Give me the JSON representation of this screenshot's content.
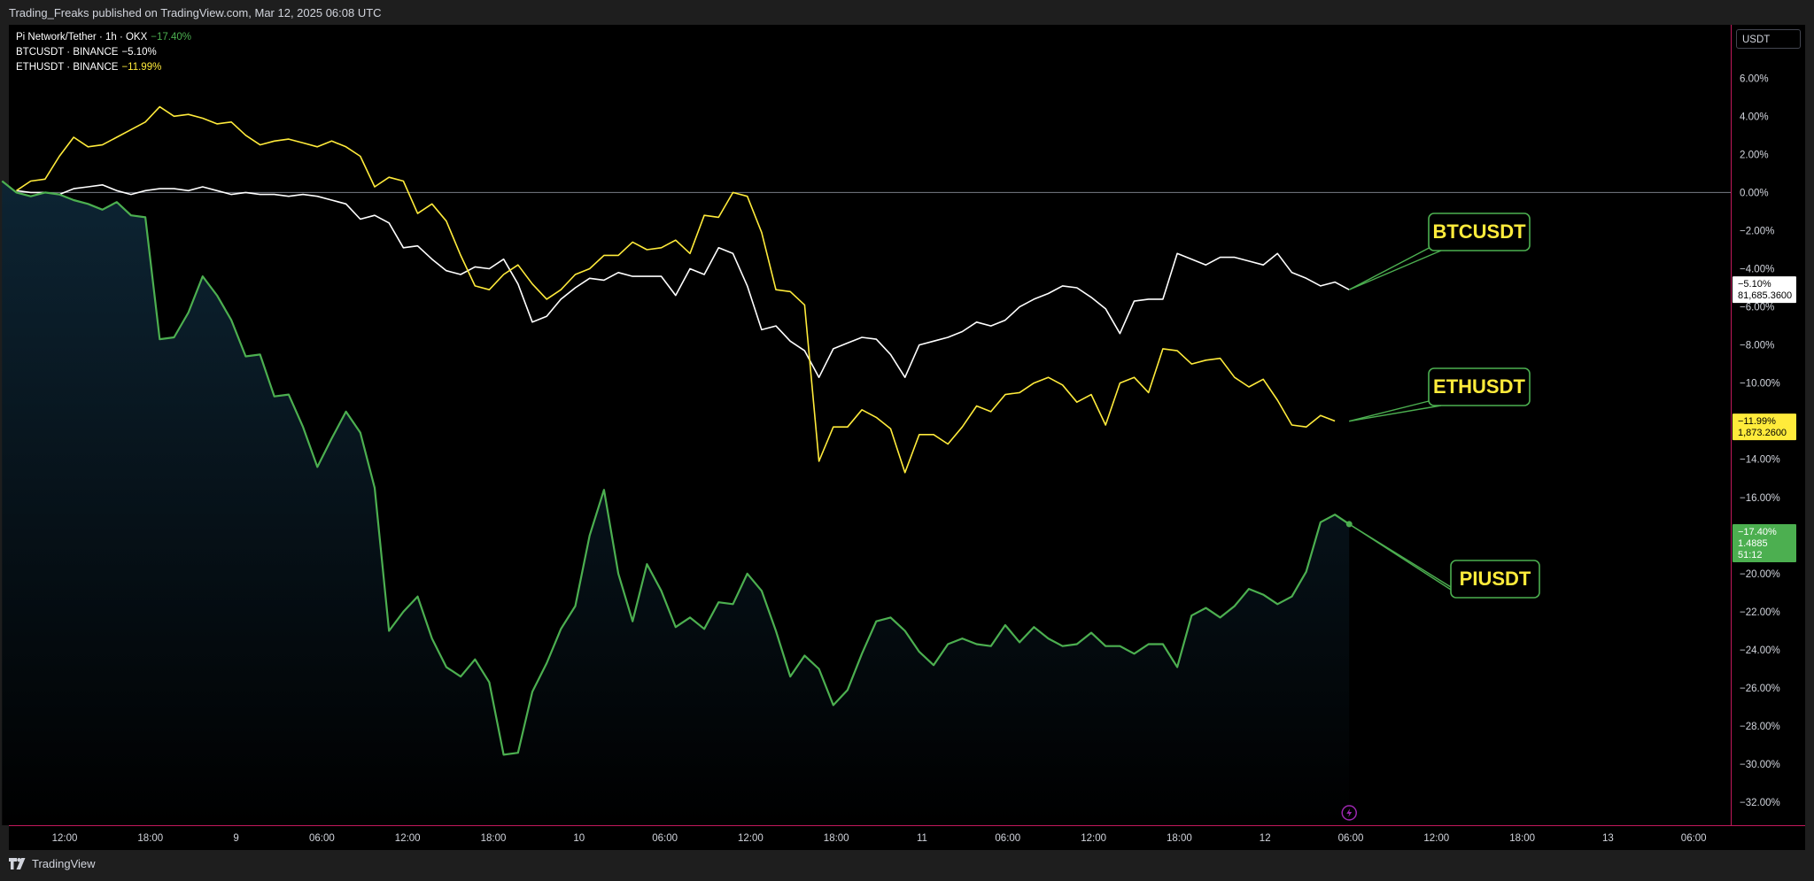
{
  "publisher_text": "Trading_Freaks published on TradingView.com, Mar 12, 2025 06:08 UTC",
  "brand": "TradingView",
  "currency_button": "USDT",
  "legend": [
    {
      "label": "Pi Network/Tether · 1h · OKX",
      "change": "−17.40%",
      "color": "#4caf50"
    },
    {
      "label": "BTCUSDT · BINANCE",
      "change": "−5.10%",
      "color": "#ffffff"
    },
    {
      "label": "ETHUSDT · BINANCE",
      "change": "−11.99%",
      "color": "#ffeb3b"
    }
  ],
  "chart_data": {
    "type": "line",
    "x_tick_labels": [
      "12:00",
      "18:00",
      "9",
      "06:00",
      "12:00",
      "18:00",
      "10",
      "06:00",
      "12:00",
      "18:00",
      "11",
      "06:00",
      "12:00",
      "18:00",
      "12",
      "06:00",
      "12:00",
      "18:00",
      "13",
      "06:00"
    ],
    "y_tick_labels": [
      "6.00%",
      "4.00%",
      "2.00%",
      "0.00%",
      "−2.00%",
      "−4.00%",
      "−6.00%",
      "−8.00%",
      "−10.00%",
      "−12.00%",
      "−14.00%",
      "−16.00%",
      "−18.00%",
      "−20.00%",
      "−22.00%",
      "−24.00%",
      "−26.00%",
      "−28.00%",
      "−30.00%",
      "−32.00%"
    ],
    "ylim": [
      -33.2,
      8.8
    ],
    "x_unit": "hours from Mar 8 06:00",
    "xlim": [
      -1.5,
      95
    ],
    "series": [
      {
        "name": "BTCUSDT",
        "color": "#ffffff",
        "points": [
          [
            0,
            0.1
          ],
          [
            1,
            0
          ],
          [
            2,
            0
          ],
          [
            3,
            -0.1
          ],
          [
            4,
            0.2
          ],
          [
            5,
            0.3
          ],
          [
            6,
            0.4
          ],
          [
            7,
            0.1
          ],
          [
            8,
            -0.1
          ],
          [
            9,
            0.1
          ],
          [
            10,
            0.2
          ],
          [
            11,
            0.2
          ],
          [
            12,
            0.1
          ],
          [
            13,
            0.3
          ],
          [
            14,
            0.1
          ],
          [
            15,
            -0.1
          ],
          [
            16,
            0
          ],
          [
            17,
            -0.1
          ],
          [
            18,
            -0.1
          ],
          [
            19,
            -0.2
          ],
          [
            20,
            -0.1
          ],
          [
            21,
            -0.2
          ],
          [
            22,
            -0.4
          ],
          [
            23,
            -0.6
          ],
          [
            24,
            -1.4
          ],
          [
            25,
            -1.2
          ],
          [
            26,
            -1.6
          ],
          [
            27,
            -2.9
          ],
          [
            28,
            -2.8
          ],
          [
            29,
            -3.5
          ],
          [
            30,
            -4.1
          ],
          [
            31,
            -4.3
          ],
          [
            32,
            -3.9
          ],
          [
            33,
            -4.0
          ],
          [
            34,
            -3.5
          ],
          [
            35,
            -4.8
          ],
          [
            36,
            -6.8
          ],
          [
            37,
            -6.5
          ],
          [
            38,
            -5.6
          ],
          [
            39,
            -5.0
          ],
          [
            40,
            -4.5
          ],
          [
            41,
            -4.6
          ],
          [
            42,
            -4.2
          ],
          [
            43,
            -4.4
          ],
          [
            44,
            -4.4
          ],
          [
            45,
            -4.4
          ],
          [
            46,
            -5.4
          ],
          [
            47,
            -4.0
          ],
          [
            48,
            -4.3
          ],
          [
            49,
            -2.9
          ],
          [
            50,
            -3.2
          ],
          [
            51,
            -4.9
          ],
          [
            52,
            -7.2
          ],
          [
            53,
            -7.0
          ],
          [
            54,
            -7.8
          ],
          [
            55,
            -8.3
          ],
          [
            56,
            -9.7
          ],
          [
            57,
            -8.2
          ],
          [
            58,
            -7.9
          ],
          [
            59,
            -7.6
          ],
          [
            60,
            -7.7
          ],
          [
            61,
            -8.5
          ],
          [
            62,
            -9.7
          ],
          [
            63,
            -8.0
          ],
          [
            64,
            -7.8
          ],
          [
            65,
            -7.6
          ],
          [
            66,
            -7.3
          ],
          [
            67,
            -6.8
          ],
          [
            68,
            -7.0
          ],
          [
            69,
            -6.7
          ],
          [
            70,
            -6.0
          ],
          [
            71,
            -5.6
          ],
          [
            72,
            -5.3
          ],
          [
            73,
            -4.9
          ],
          [
            74,
            -5.0
          ],
          [
            75,
            -5.5
          ],
          [
            76,
            -6.1
          ],
          [
            77,
            -7.4
          ],
          [
            78,
            -5.7
          ],
          [
            79,
            -5.6
          ],
          [
            80,
            -5.6
          ],
          [
            81,
            -3.2
          ],
          [
            82,
            -3.5
          ],
          [
            83,
            -3.8
          ],
          [
            84,
            -3.4
          ],
          [
            85,
            -3.4
          ],
          [
            86,
            -3.6
          ],
          [
            87,
            -3.8
          ],
          [
            88,
            -3.2
          ],
          [
            89,
            -4.2
          ],
          [
            90,
            -4.5
          ],
          [
            91,
            -4.9
          ],
          [
            92,
            -4.7
          ],
          [
            93,
            -5.1
          ]
        ]
      },
      {
        "name": "ETHUSDT",
        "color": "#ffeb3b",
        "points": [
          [
            0,
            0.1
          ],
          [
            1,
            0.6
          ],
          [
            2,
            0.7
          ],
          [
            3,
            1.9
          ],
          [
            4,
            2.9
          ],
          [
            5,
            2.4
          ],
          [
            6,
            2.5
          ],
          [
            7,
            2.9
          ],
          [
            8,
            3.3
          ],
          [
            9,
            3.7
          ],
          [
            10,
            4.5
          ],
          [
            11,
            4.0
          ],
          [
            12,
            4.1
          ],
          [
            13,
            3.9
          ],
          [
            14,
            3.6
          ],
          [
            15,
            3.7
          ],
          [
            16,
            3.0
          ],
          [
            17,
            2.5
          ],
          [
            18,
            2.7
          ],
          [
            19,
            2.8
          ],
          [
            20,
            2.6
          ],
          [
            21,
            2.4
          ],
          [
            22,
            2.7
          ],
          [
            23,
            2.4
          ],
          [
            24,
            1.9
          ],
          [
            25,
            0.3
          ],
          [
            26,
            0.8
          ],
          [
            27,
            0.6
          ],
          [
            28,
            -1.1
          ],
          [
            29,
            -0.6
          ],
          [
            30,
            -1.5
          ],
          [
            31,
            -3.3
          ],
          [
            32,
            -4.9
          ],
          [
            33,
            -5.1
          ],
          [
            34,
            -4.3
          ],
          [
            35,
            -3.8
          ],
          [
            36,
            -4.8
          ],
          [
            37,
            -5.6
          ],
          [
            38,
            -5.1
          ],
          [
            39,
            -4.3
          ],
          [
            40,
            -4.0
          ],
          [
            41,
            -3.3
          ],
          [
            42,
            -3.3
          ],
          [
            43,
            -2.6
          ],
          [
            44,
            -3.0
          ],
          [
            45,
            -2.9
          ],
          [
            46,
            -2.5
          ],
          [
            47,
            -3.2
          ],
          [
            48,
            -1.2
          ],
          [
            49,
            -1.3
          ],
          [
            50,
            0
          ],
          [
            51,
            -0.2
          ],
          [
            52,
            -2.1
          ],
          [
            53,
            -5.1
          ],
          [
            54,
            -5.2
          ],
          [
            55,
            -5.9
          ],
          [
            56,
            -14.1
          ],
          [
            57,
            -12.3
          ],
          [
            58,
            -12.3
          ],
          [
            59,
            -11.4
          ],
          [
            60,
            -11.8
          ],
          [
            61,
            -12.4
          ],
          [
            62,
            -14.7
          ],
          [
            63,
            -12.7
          ],
          [
            64,
            -12.7
          ],
          [
            65,
            -13.2
          ],
          [
            66,
            -12.3
          ],
          [
            67,
            -11.2
          ],
          [
            68,
            -11.5
          ],
          [
            69,
            -10.6
          ],
          [
            70,
            -10.5
          ],
          [
            71,
            -10.0
          ],
          [
            72,
            -9.7
          ],
          [
            73,
            -10.1
          ],
          [
            74,
            -11.0
          ],
          [
            75,
            -10.6
          ],
          [
            76,
            -12.2
          ],
          [
            77,
            -10.0
          ],
          [
            78,
            -9.7
          ],
          [
            79,
            -10.5
          ],
          [
            80,
            -8.2
          ],
          [
            81,
            -8.3
          ],
          [
            82,
            -9.0
          ],
          [
            83,
            -8.8
          ],
          [
            84,
            -8.7
          ],
          [
            85,
            -9.7
          ],
          [
            86,
            -10.2
          ],
          [
            87,
            -9.8
          ],
          [
            88,
            -10.9
          ],
          [
            89,
            -12.2
          ],
          [
            90,
            -12.3
          ],
          [
            91,
            -11.7
          ],
          [
            92,
            -11.99
          ]
        ]
      },
      {
        "name": "PIUSDT",
        "color": "#4caf50",
        "points": [
          [
            -1,
            0.6
          ],
          [
            0,
            0
          ],
          [
            1,
            -0.2
          ],
          [
            2,
            0
          ],
          [
            3,
            -0.1
          ],
          [
            4,
            -0.4
          ],
          [
            5,
            -0.6
          ],
          [
            6,
            -0.9
          ],
          [
            7,
            -0.5
          ],
          [
            8,
            -1.2
          ],
          [
            9,
            -1.3
          ],
          [
            10,
            -7.7
          ],
          [
            11,
            -7.6
          ],
          [
            12,
            -6.3
          ],
          [
            13,
            -4.4
          ],
          [
            14,
            -5.4
          ],
          [
            15,
            -6.7
          ],
          [
            16,
            -8.6
          ],
          [
            17,
            -8.5
          ],
          [
            18,
            -10.7
          ],
          [
            19,
            -10.6
          ],
          [
            20,
            -12.3
          ],
          [
            21,
            -14.4
          ],
          [
            22,
            -12.9
          ],
          [
            23,
            -11.5
          ],
          [
            24,
            -12.6
          ],
          [
            25,
            -15.5
          ],
          [
            26,
            -23.0
          ],
          [
            27,
            -22.0
          ],
          [
            28,
            -21.2
          ],
          [
            29,
            -23.4
          ],
          [
            30,
            -24.9
          ],
          [
            31,
            -25.4
          ],
          [
            32,
            -24.5
          ],
          [
            33,
            -25.7
          ],
          [
            34,
            -29.5
          ],
          [
            35,
            -29.4
          ],
          [
            36,
            -26.2
          ],
          [
            37,
            -24.7
          ],
          [
            38,
            -22.9
          ],
          [
            39,
            -21.7
          ],
          [
            40,
            -18.0
          ],
          [
            41,
            -15.6
          ],
          [
            42,
            -20.0
          ],
          [
            43,
            -22.5
          ],
          [
            44,
            -19.5
          ],
          [
            45,
            -20.9
          ],
          [
            46,
            -22.8
          ],
          [
            47,
            -22.3
          ],
          [
            48,
            -22.9
          ],
          [
            49,
            -21.5
          ],
          [
            50,
            -21.6
          ],
          [
            51,
            -20.0
          ],
          [
            52,
            -20.9
          ],
          [
            53,
            -23.0
          ],
          [
            54,
            -25.4
          ],
          [
            55,
            -24.3
          ],
          [
            56,
            -25.0
          ],
          [
            57,
            -26.9
          ],
          [
            58,
            -26.1
          ],
          [
            59,
            -24.2
          ],
          [
            60,
            -22.5
          ],
          [
            61,
            -22.3
          ],
          [
            62,
            -23.0
          ],
          [
            63,
            -24.1
          ],
          [
            64,
            -24.8
          ],
          [
            65,
            -23.7
          ],
          [
            66,
            -23.4
          ],
          [
            67,
            -23.7
          ],
          [
            68,
            -23.8
          ],
          [
            69,
            -22.7
          ],
          [
            70,
            -23.6
          ],
          [
            71,
            -22.8
          ],
          [
            72,
            -23.4
          ],
          [
            73,
            -23.8
          ],
          [
            74,
            -23.7
          ],
          [
            75,
            -23.1
          ],
          [
            76,
            -23.8
          ],
          [
            77,
            -23.8
          ],
          [
            78,
            -24.2
          ],
          [
            79,
            -23.7
          ],
          [
            80,
            -23.7
          ],
          [
            81,
            -24.9
          ],
          [
            82,
            -22.2
          ],
          [
            83,
            -21.8
          ],
          [
            84,
            -22.3
          ],
          [
            85,
            -21.7
          ],
          [
            86,
            -20.8
          ],
          [
            87,
            -21.1
          ],
          [
            88,
            -21.6
          ],
          [
            89,
            -21.2
          ],
          [
            90,
            -19.9
          ],
          [
            91,
            -17.3
          ],
          [
            92,
            -16.9
          ],
          [
            93,
            -17.4
          ]
        ]
      }
    ],
    "price_labels": [
      {
        "pct": "−5.10%",
        "price": "81,685.3600",
        "bg": "#ffffff",
        "fg": "#000000",
        "y": -5.1
      },
      {
        "pct": "−11.99%",
        "price": "1,873.2600",
        "bg": "#ffeb3b",
        "fg": "#000000",
        "y": -12.3
      },
      {
        "pct": "−17.40%",
        "price": "1.4885",
        "extra": "51:12",
        "bg": "#4caf50",
        "fg": "#ffffff",
        "y": -18.4
      }
    ],
    "annotations": [
      {
        "text": "BTCUSDT",
        "anchor": [
          93,
          -5.1
        ],
        "box_x": 1613,
        "box_y": 241
      },
      {
        "text": "ETHUSDT",
        "anchor": [
          93,
          -12.0
        ],
        "box_x": 1613,
        "box_y": 416
      },
      {
        "text": "PIUSDT",
        "anchor": [
          93,
          -17.4
        ],
        "box_x": 1638,
        "box_y": 633
      }
    ]
  }
}
